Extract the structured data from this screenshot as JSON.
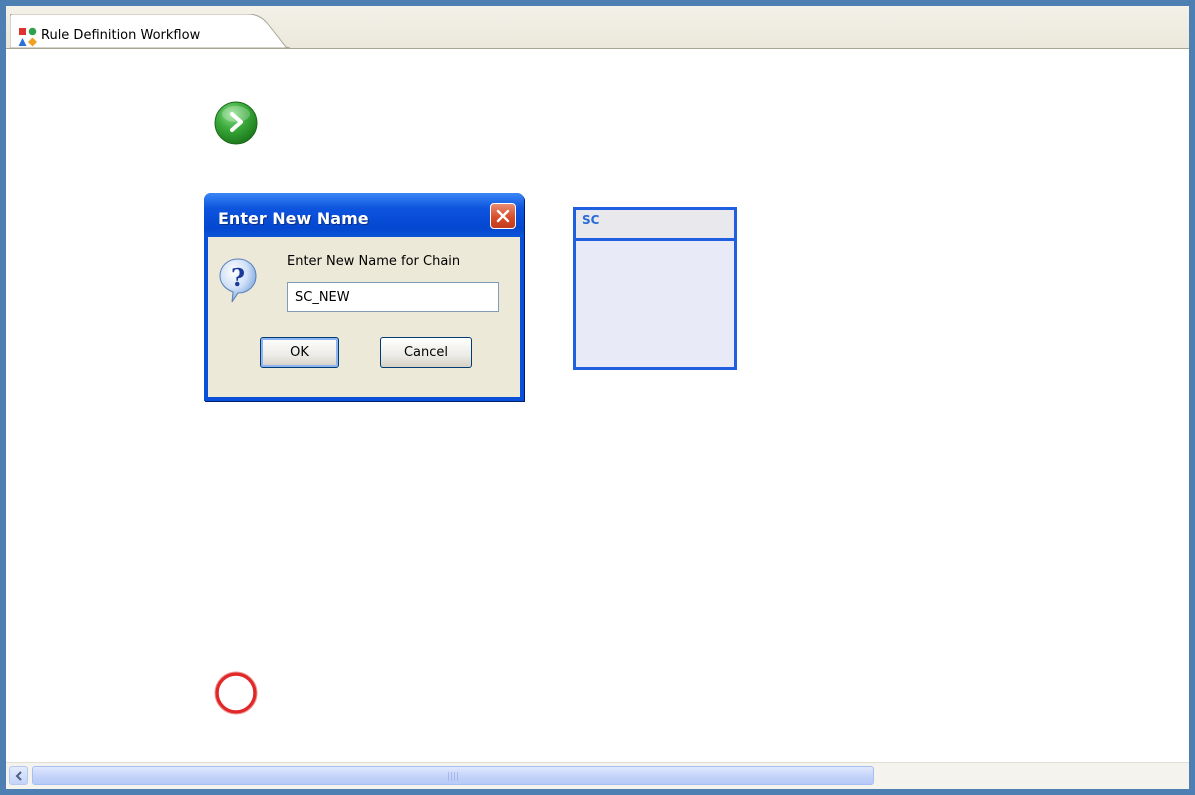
{
  "editor": {
    "tab_title": "Rule Definition Workflow",
    "tab_icon": "shapes-icon"
  },
  "workflow": {
    "start_node_icon": "start-arrow-icon",
    "end_node_icon": "end-circle-icon",
    "chain_box": {
      "title": "SC"
    }
  },
  "dialog": {
    "title": "Enter New Name",
    "prompt": "Enter New Name for Chain",
    "input_value": "SC_NEW",
    "ok_label": "OK",
    "cancel_label": "Cancel",
    "icon": "question-icon"
  },
  "colors": {
    "window_border": "#4d7fb3",
    "chain_border": "#2060e0",
    "dialog_blue": "#0a4fd8",
    "start_green": "#2e9a2e",
    "end_red": "#e02020"
  }
}
